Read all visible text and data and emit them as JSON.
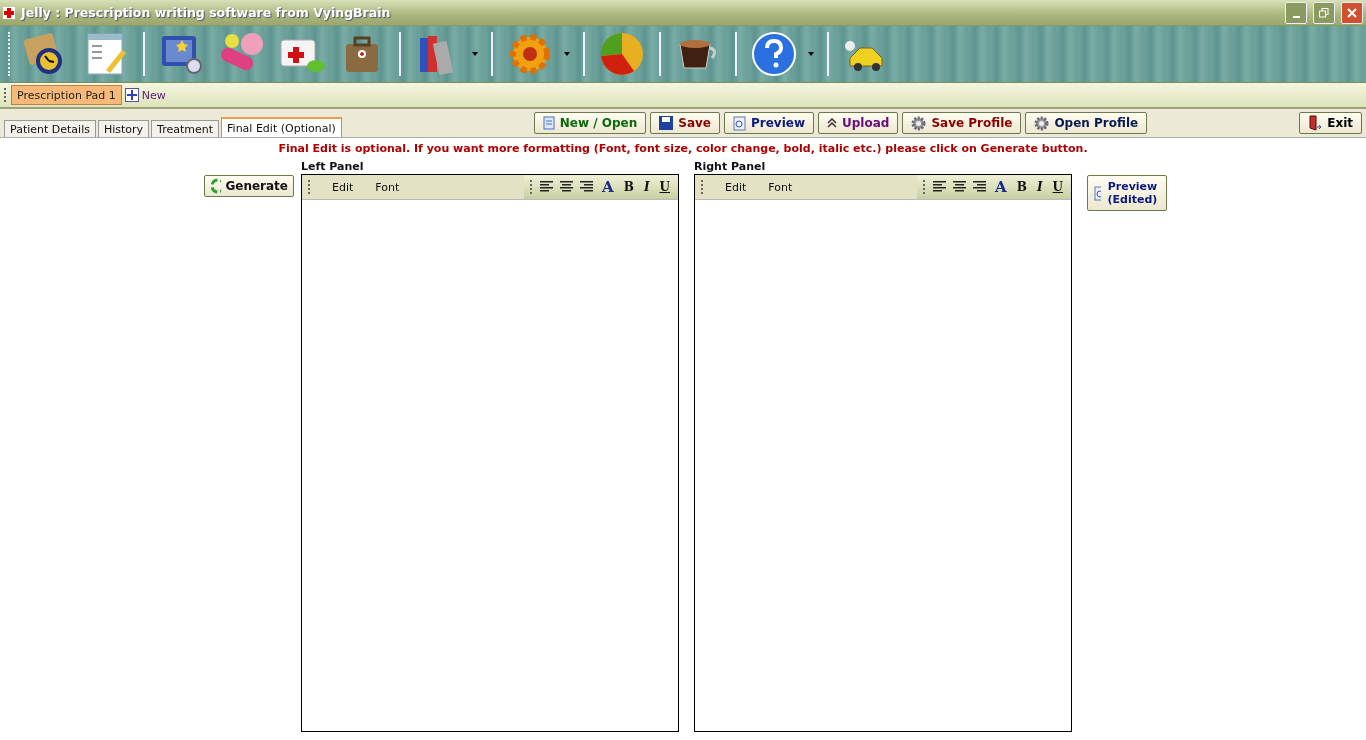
{
  "window": {
    "title": "Jelly : Prescription writing software from VyingBrain"
  },
  "toolbar": [
    {
      "kind": "book-clock",
      "dropdown": false
    },
    {
      "kind": "notepad",
      "dropdown": false
    },
    {
      "kind": "separator"
    },
    {
      "kind": "photo",
      "dropdown": false
    },
    {
      "kind": "pills",
      "dropdown": false
    },
    {
      "kind": "medkit",
      "dropdown": false
    },
    {
      "kind": "bag",
      "dropdown": false
    },
    {
      "kind": "separator"
    },
    {
      "kind": "books",
      "dropdown": true
    },
    {
      "kind": "separator"
    },
    {
      "kind": "gear",
      "dropdown": true
    },
    {
      "kind": "separator"
    },
    {
      "kind": "pie",
      "dropdown": false
    },
    {
      "kind": "separator"
    },
    {
      "kind": "coffee",
      "dropdown": false
    },
    {
      "kind": "separator"
    },
    {
      "kind": "help",
      "dropdown": true
    },
    {
      "kind": "separator"
    },
    {
      "kind": "car",
      "dropdown": false
    }
  ],
  "documents": [
    {
      "label": "Prescription Pad 1",
      "selected": true
    }
  ],
  "new_document": "New",
  "tabs": [
    {
      "label": "Patient Details",
      "selected": false
    },
    {
      "label": "History",
      "selected": false
    },
    {
      "label": "Treatment",
      "selected": false
    },
    {
      "label": "Final Edit (Optional)",
      "selected": true
    }
  ],
  "actions": [
    {
      "label": "New / Open",
      "kind": "doc",
      "color": "#0a6a0a"
    },
    {
      "label": "Save",
      "kind": "disk",
      "color": "#8b0000"
    },
    {
      "label": "Preview",
      "kind": "preview",
      "color": "#0a1a80"
    },
    {
      "label": "Upload",
      "kind": "upload",
      "color": "#6a0a7a"
    },
    {
      "label": "Save Profile",
      "kind": "gear",
      "color": "#8b0000"
    },
    {
      "label": "Open Profile",
      "kind": "gear",
      "color": "#0a1a50"
    },
    {
      "label": "Exit",
      "kind": "exit",
      "color": "#000000"
    }
  ],
  "notice": "Final Edit is optional. If you want more formatting (Font, font size, color change, bold, italic etc.) please click on Generate button.",
  "generate": "Generate",
  "panels": [
    {
      "title": "Left Panel",
      "menu": [
        "Edit",
        "Font"
      ],
      "format": [
        "A",
        "B",
        "I",
        "U"
      ]
    },
    {
      "title": "Right Panel",
      "menu": [
        "Edit",
        "Font"
      ],
      "format": [
        "A",
        "B",
        "I",
        "U"
      ]
    }
  ],
  "preview_edited": "Preview (Edited)"
}
